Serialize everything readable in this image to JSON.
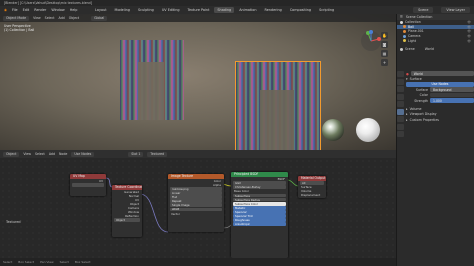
{
  "window": {
    "title": "[Blender] [C:\\Users\\Vahud\\Desktop\\mix textures.blend]"
  },
  "menu": {
    "items": [
      "File",
      "Edit",
      "Render",
      "Window",
      "Help"
    ],
    "workspaces": [
      "Layout",
      "Modeling",
      "Sculpting",
      "UV Editing",
      "Texture Paint",
      "Shading",
      "Animation",
      "Rendering",
      "Compositing",
      "Scripting"
    ],
    "active_workspace": "Shading",
    "scene": "Scene",
    "view_layer": "View Layer"
  },
  "viewport": {
    "mode": "Object Mode",
    "menus": [
      "View",
      "Select",
      "Add",
      "Object"
    ],
    "shading": "Global",
    "info_line1": "User Perspective",
    "info_line2": "(1) Collection | Ball",
    "tools": [
      "hand-icon",
      "camera-icon",
      "grid-icon",
      "zoom-icon"
    ]
  },
  "outliner": {
    "header": "Scene Collection",
    "rows": [
      {
        "label": "Collection",
        "color": "#d9d9d9",
        "selected": false
      },
      {
        "label": "Ball",
        "color": "#e08a3a",
        "selected": true
      },
      {
        "label": "Plane.001",
        "color": "#e08a3a",
        "selected": false
      },
      {
        "label": "Camera",
        "color": "#6ea0d8",
        "selected": false
      },
      {
        "label": "Light",
        "color": "#e0c24a",
        "selected": false
      },
      {
        "label": "Scene",
        "color": "#c8c8c8",
        "selected": false
      }
    ]
  },
  "properties": {
    "world_name": "World",
    "scene_label": "Scene",
    "world_field": "World",
    "surface_panel": "Surface",
    "use_nodes": "Use Nodes",
    "surface_label": "Surface",
    "surface_value": "Background",
    "color_label": "Color",
    "strength_label": "Strength",
    "strength_value": "1.000",
    "sections": [
      "Volume",
      "Viewport Display",
      "Custom Properties"
    ]
  },
  "node_editor": {
    "type": "Object",
    "menus": [
      "View",
      "Select",
      "Add",
      "Node"
    ],
    "use_nodes": "Use Nodes",
    "slot": "Slot 1",
    "material": "Textured",
    "label": "Textured",
    "footer": [
      "Select",
      "Box Select",
      "Pan View",
      "Select",
      "Box Select"
    ],
    "nodes": {
      "uv": {
        "title": "UV Map",
        "out": "UV",
        "field": ""
      },
      "tex1": {
        "title": "Texture Coordinate",
        "outs": [
          "Generated",
          "Normal",
          "UV",
          "Object",
          "Camera",
          "Window",
          "Reflection"
        ],
        "field": "Object",
        "extra": "From Instancer"
      },
      "tex2": {
        "title": "Image Texture",
        "outs": [
          "Color",
          "Alpha"
        ],
        "fields": [
          "rainbow.png",
          "Linear",
          "Flat",
          "Repeat",
          "Single Image",
          "sRGB"
        ],
        "vector": "Vector"
      },
      "bsdf": {
        "title": "Principled BSDF",
        "out": "BSDF",
        "fields": [
          "GGX",
          "Christensen-Burley",
          "Base Color",
          "Subsurface",
          "Subsurface Radius",
          "Subsurface Color",
          "Metallic",
          "Specular",
          "Specular Tint",
          "Roughness",
          "Anisotropic"
        ],
        "values": [
          "0.000",
          "0.000",
          "0.500",
          "0.000",
          "0.500",
          "0.000"
        ]
      },
      "output": {
        "title": "Material Output",
        "sel": "All",
        "ins": [
          "Surface",
          "Volume",
          "Displacement"
        ]
      }
    }
  }
}
